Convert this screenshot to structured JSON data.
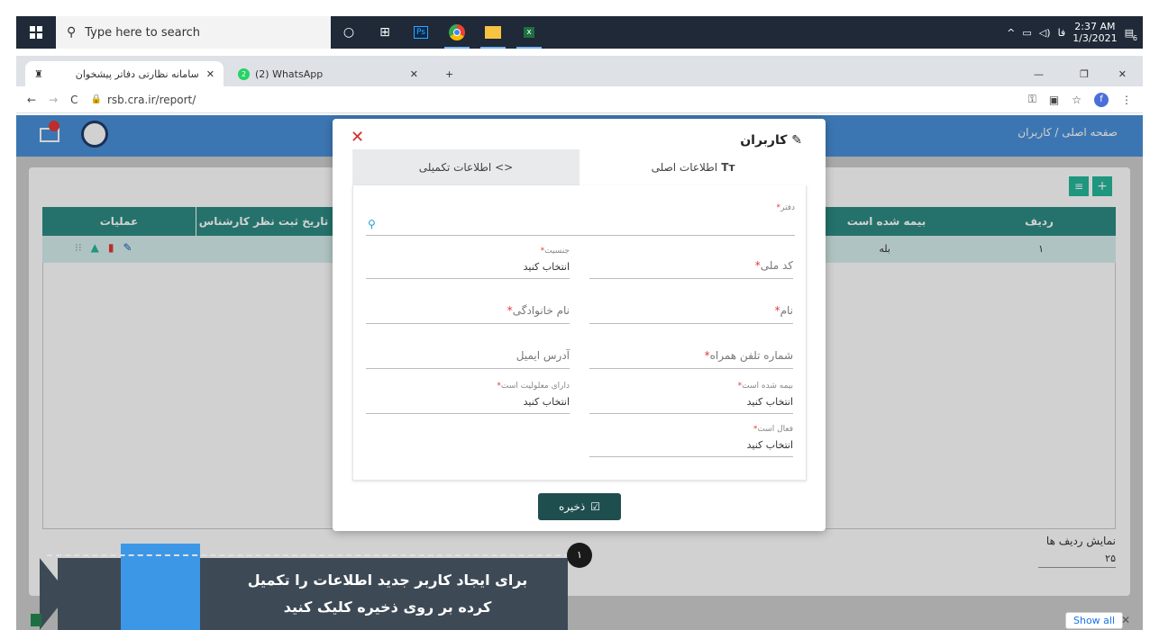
{
  "taskbar": {
    "search_placeholder": "Type here to search",
    "time": "2:37 AM",
    "date": "1/3/2021",
    "lang": "فا",
    "notif_count": "6"
  },
  "browser": {
    "tab1_title": "سامانه نظارتی دفاتر پیشخوان",
    "tab2_title": "(2) WhatsApp",
    "tab2_badge": "2",
    "url": "rsb.cra.ir/report/",
    "profile_initial": "f",
    "download_bar_show_all": "Show all"
  },
  "app": {
    "breadcrumb_home": "صفحه اصلی",
    "breadcrumb_sep": " / ",
    "breadcrumb_current": "کاربران",
    "table": {
      "headers": [
        "ردیف",
        "بیمه شده است",
        "تاریخ ثبت نظر کارشناس",
        "عملیات"
      ],
      "row": {
        "index": "۱",
        "insured": "بله"
      }
    },
    "rows_per_page_label": "نمایش ردیف ها",
    "rows_per_page_value": "۲۵"
  },
  "modal": {
    "title": "کاربران",
    "tab_main": "اطلاعات اصلی",
    "tab_extra": "اطلاعات تکمیلی",
    "fields": {
      "office_label": "دفتر",
      "national_code_label": "کد ملی",
      "gender_label": "جنسیت",
      "gender_value": "انتخاب کنید",
      "first_name_label": "نام",
      "last_name_label": "نام خانوادگی",
      "mobile_label": "شماره تلفن همراه",
      "email_label": "آدرس ایمیل",
      "insured_label": "بیمه شده است",
      "insured_value": "انتخاب کنید",
      "disability_label": "دارای معلولیت است",
      "disability_value": "انتخاب کنید",
      "active_label": "فعال است",
      "active_value": "انتخاب کنید"
    },
    "save_label": "ذخیره"
  },
  "tutorial": {
    "text_line1": "برای ایجاد کاربر جدید اطلاعات را تکمیل",
    "text_line2": "کرده بر روی ذخیره کلیک کنید",
    "step": "۱"
  },
  "colors": {
    "appbar": "#4a90d9",
    "table_header": "#2c8c83",
    "save_button": "#1f4e4f",
    "close": "#d52b2b",
    "required": "#e53935"
  }
}
